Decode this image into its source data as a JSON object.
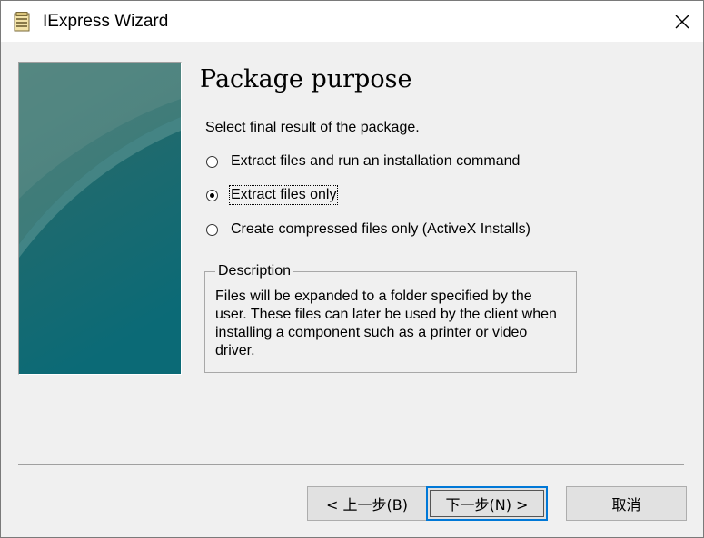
{
  "window": {
    "title": "IExpress Wizard"
  },
  "page": {
    "title": "Package purpose",
    "prompt": "Select final result of the package."
  },
  "options": [
    {
      "label": "Extract files and run an installation command",
      "checked": false
    },
    {
      "label": "Extract files only",
      "checked": true
    },
    {
      "label": "Create compressed files only (ActiveX Installs)",
      "checked": false
    }
  ],
  "description": {
    "legend": "Description",
    "text": "Files will be expanded to a folder specified by the user. These files can later be used by the client when installing a component such as a printer or video driver."
  },
  "buttons": {
    "back": "< 上一步(B)",
    "next": "下一步(N) >",
    "cancel": "取消"
  },
  "colors": {
    "focus_border": "#0078d7",
    "side_image_top": "#2f6f6c",
    "side_image_bottom": "#0c6e78"
  },
  "icons": {
    "app": "installer-package-icon",
    "close": "close-icon"
  }
}
